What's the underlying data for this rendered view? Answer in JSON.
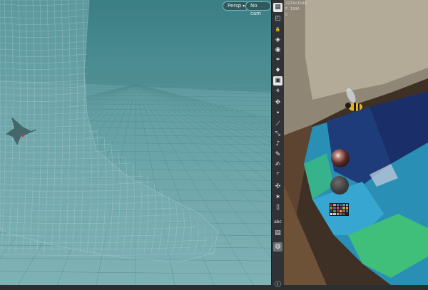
{
  "viewport": {
    "camera_mode": "Persp",
    "camera_name": "No cam",
    "colors": {
      "sky": "#3a7f84",
      "ground": "#6fa8ac",
      "wireframe": "#9cc3c6"
    }
  },
  "toolbar": {
    "tools": [
      {
        "name": "grid-toggle-icon",
        "glyph": "▦"
      },
      {
        "name": "camera-view-icon",
        "glyph": "◰"
      },
      {
        "name": "lock-icon",
        "glyph": "🔒"
      },
      {
        "name": "eye-drop-icon",
        "glyph": "◈"
      },
      {
        "name": "render-sphere-icon",
        "glyph": "◉"
      },
      {
        "name": "light-icon",
        "glyph": "⚭"
      },
      {
        "name": "bulb-icon",
        "glyph": "♦"
      },
      {
        "name": "image-plane-icon",
        "glyph": "▣"
      },
      {
        "name": "nodes-icon",
        "glyph": "⚹"
      },
      {
        "name": "transform-icon",
        "glyph": "✥"
      },
      {
        "name": "point-icon",
        "glyph": "•"
      },
      {
        "name": "edge-icon",
        "glyph": "⟋"
      },
      {
        "name": "measure-icon",
        "glyph": "⤡"
      },
      {
        "name": "bezier-icon",
        "glyph": "♪"
      },
      {
        "name": "paint-icon",
        "glyph": "✎"
      },
      {
        "name": "brush-icon",
        "glyph": "✍"
      },
      {
        "name": "crop-icon",
        "glyph": "⌜"
      },
      {
        "name": "scale-icon",
        "glyph": "✣"
      },
      {
        "name": "pin-icon",
        "glyph": "✶"
      },
      {
        "name": "trash-icon",
        "glyph": "▯"
      },
      {
        "name": "text-tool-icon",
        "glyph": "abc"
      },
      {
        "name": "layers-icon",
        "glyph": "▤"
      },
      {
        "name": "locator-icon",
        "glyph": "◍"
      },
      {
        "name": "info-icon",
        "glyph": "ⓘ"
      }
    ]
  },
  "photo": {
    "info_lines": [
      "2234x1548",
      "F 1996",
      "C"
    ],
    "checker_colors": [
      "#6b4a3a",
      "#c49378",
      "#5d7aa2",
      "#566c3f",
      "#7f7db4",
      "#5bbcaa",
      "#d4822a",
      "#4a5ea6",
      "#c25a62",
      "#5a3c6a",
      "#9cbc3c",
      "#e0a22c",
      "#2c3a8c",
      "#4a9448",
      "#b0303a",
      "#e8c820",
      "#b8508c",
      "#1c84a8",
      "#f0f0f0",
      "#c8c8c8",
      "#a0a0a0",
      "#787878",
      "#505050",
      "#282828"
    ]
  }
}
